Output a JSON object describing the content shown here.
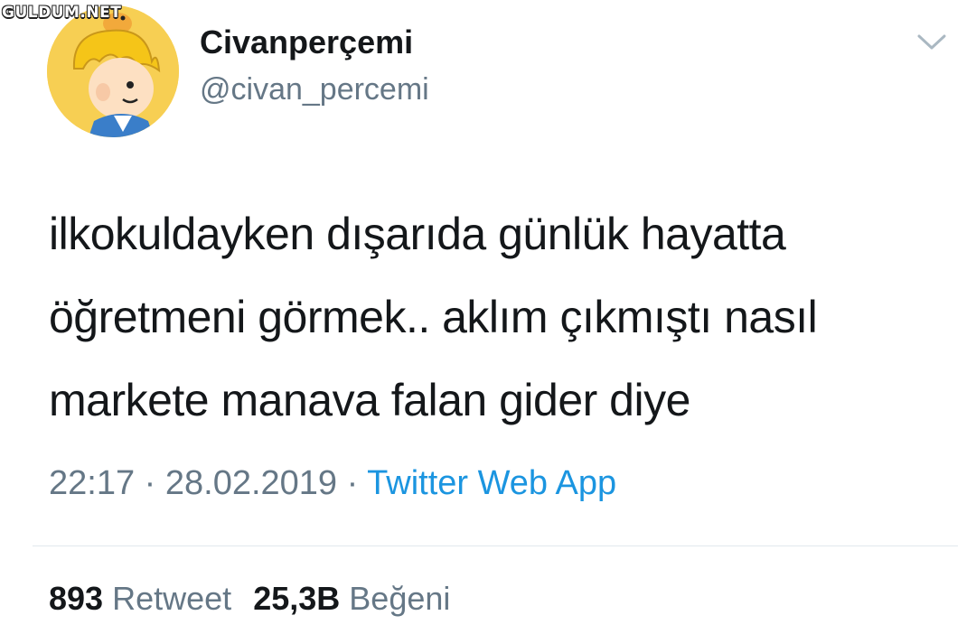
{
  "watermark": "GULDUM.NET",
  "author": {
    "display_name": "Civanperçemi",
    "username": "@civan_percemi",
    "avatar": "cartoon-avatar"
  },
  "tweet": {
    "lines": [
      "ilkokuldayken dışarıda günlük hayatta",
      "öğretmeni görmek.. aklım çıkmıştı nasıl",
      "markete manava falan gider diye"
    ],
    "time": "22:17",
    "date": "28.02.2019",
    "separator": "·",
    "source": "Twitter Web App"
  },
  "stats": {
    "retweets": {
      "count": "893",
      "label": "Retweet"
    },
    "likes": {
      "count": "25,3B",
      "label": "Beğeni"
    }
  },
  "icons": {
    "more": "chevron-down-icon"
  },
  "colors": {
    "text": "#14171a",
    "secondary": "#657786",
    "link": "#1b95e0",
    "divider": "#e1e8ed",
    "avatar_bg": "#f7cf53"
  }
}
